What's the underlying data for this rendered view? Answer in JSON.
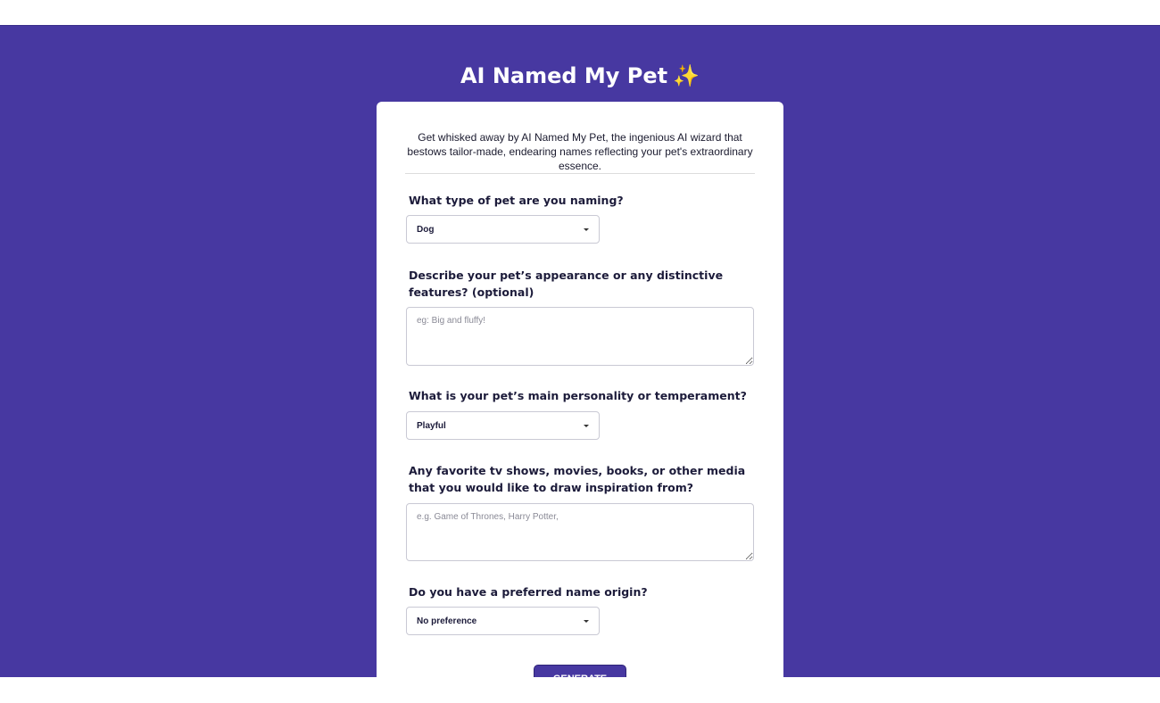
{
  "header": {
    "title": "AI Named My Pet",
    "title_emoji": "✨"
  },
  "intro": {
    "text": "Get whisked away by AI Named My Pet, the ingenious AI wizard that bestows tailor-made, endearing names reflecting your pet's extraordinary essence."
  },
  "form": {
    "pet_type": {
      "label": "What type of pet are you naming?",
      "value": "Dog"
    },
    "appearance": {
      "label": "Describe your pet’s appearance or any distinctive features? (optional)",
      "placeholder": "eg: Big and fluffy!"
    },
    "personality": {
      "label": "What is your pet’s main personality or temperament?",
      "value": "Playful"
    },
    "media": {
      "label": "Any favorite tv shows, movies, books, or other media that you would like to draw inspiration from?",
      "placeholder": "e.g. Game of Thrones, Harry Potter,"
    },
    "origin": {
      "label": "Do you have a preferred name origin?",
      "value": "No preference"
    },
    "submit_label": "Generate Names"
  },
  "colors": {
    "background": "#4738a1",
    "card": "#ffffff",
    "text": "#1c1b3a"
  }
}
